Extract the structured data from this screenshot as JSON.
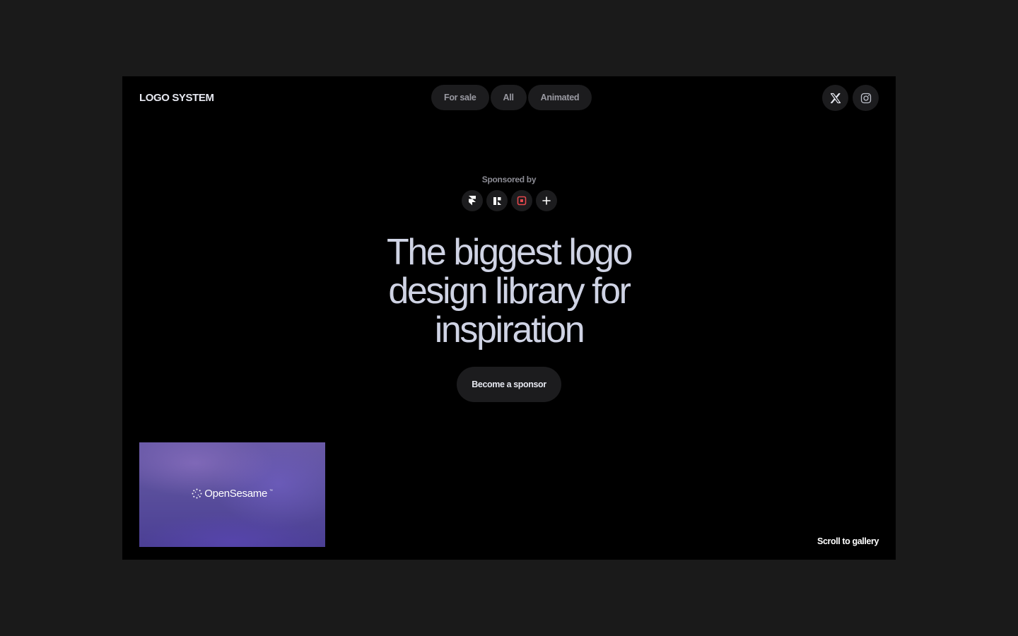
{
  "header": {
    "brand": "LOGO SYSTEM",
    "nav": [
      {
        "label": "For sale"
      },
      {
        "label": "All"
      },
      {
        "label": "Animated"
      }
    ],
    "social": [
      "x-icon",
      "instagram-icon"
    ]
  },
  "hero": {
    "sponsored_label": "Sponsored by",
    "sponsors": [
      "framer-icon",
      "relume-icon",
      "square-logo-icon",
      "plus-icon"
    ],
    "headline_lines": [
      "The biggest logo",
      "design library for",
      "inspiration"
    ],
    "cta_label": "Become a sponsor"
  },
  "gallery": {
    "card": {
      "logo_text": "OpenSesame",
      "trademark": "™"
    },
    "scroll_label": "Scroll to gallery"
  },
  "colors": {
    "page_bg": "#1a1a1a",
    "frame_bg": "#000000",
    "pill_bg": "#1c1c1e",
    "headline": "#cfd3e4",
    "sponsor_accent": "#e5484d",
    "card_purple": "#5a4f9c"
  }
}
